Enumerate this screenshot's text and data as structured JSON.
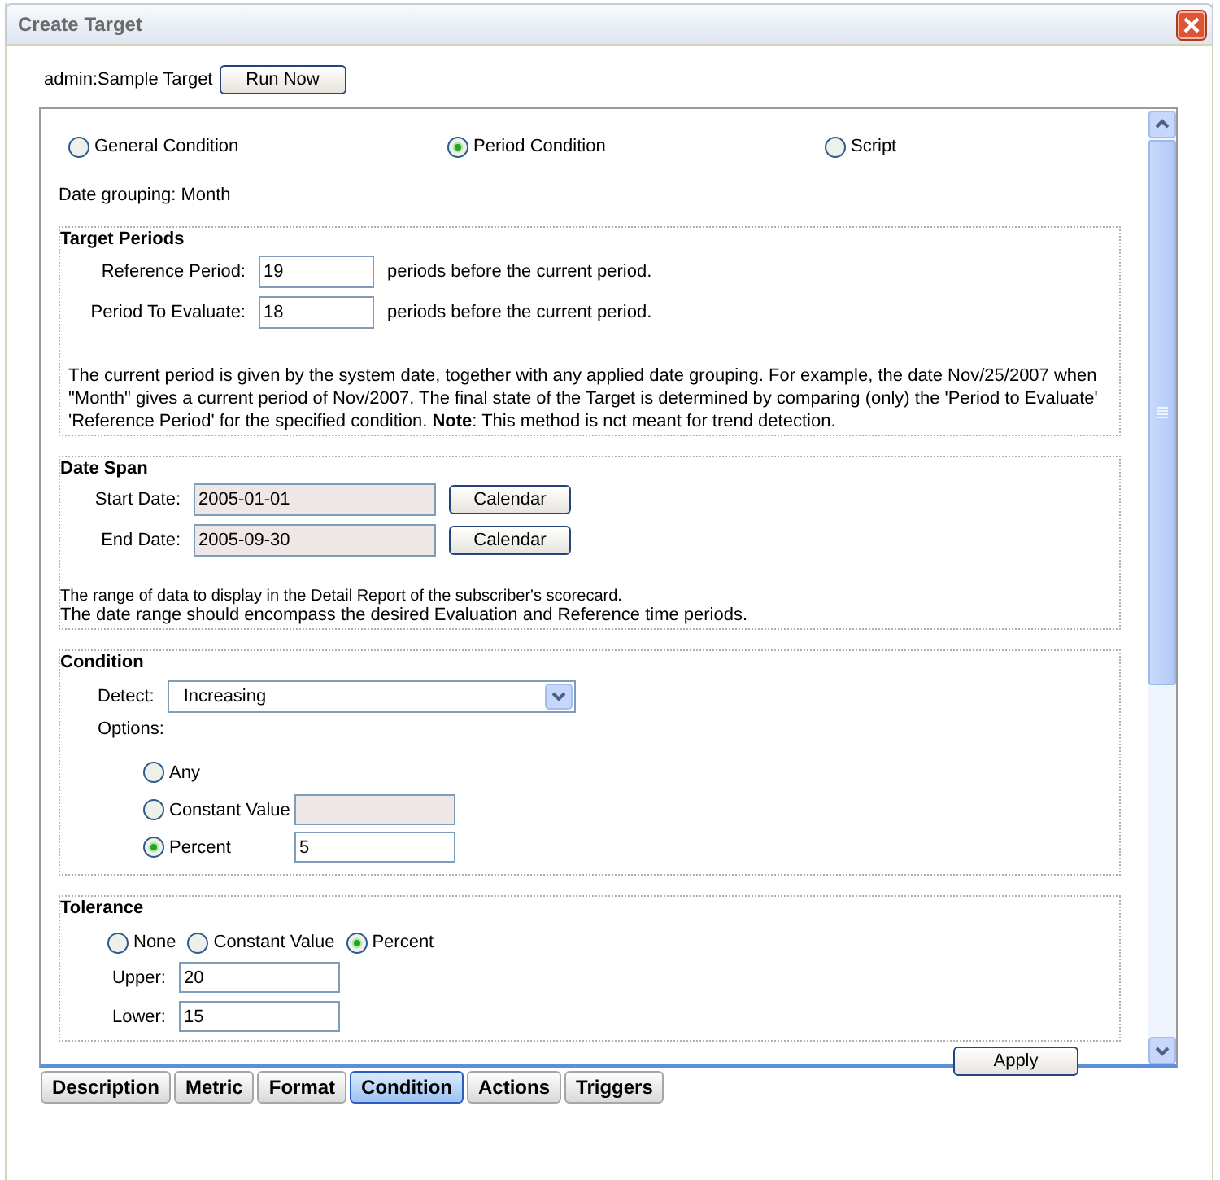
{
  "window": {
    "title": "Create Target"
  },
  "header": {
    "target": "admin:Sample Target",
    "run_button": "Run Now"
  },
  "condition_types": [
    {
      "label": "General Condition",
      "selected": false
    },
    {
      "label": "Period Condition",
      "selected": true
    },
    {
      "label": "Script",
      "selected": false
    }
  ],
  "date_grouping": "Date grouping: Month",
  "target_periods": {
    "title": "Target Periods",
    "fields": [
      {
        "label": "Reference Period:",
        "value": "19",
        "suffix": "periods before the current period."
      },
      {
        "label": "Period To Evaluate:",
        "value": "18",
        "suffix": "periods before the current period."
      }
    ],
    "note": "The current period is given by the system date, together with any applied date grouping. For example, the date Nov/25/2007 when\n\"Month\" gives a current period of Nov/2007. The final state of the Target is determined by comparing (only) the 'Period to Evaluate'\n'Reference Period' for the specified condition. **Note**: This method is nct meant for trend detection."
  },
  "date_span": {
    "title": "Date Span",
    "fields": [
      {
        "label": "Start Date:",
        "value": "2005-01-01",
        "button": "Calendar"
      },
      {
        "label": "End Date:",
        "value": "2005-09-30",
        "button": "Calendar"
      }
    ],
    "hint": "The range of data to display in the Detail Report of the subscriber's scorecard.",
    "note": "The date range should encompass the desired Evaluation and Reference time periods."
  },
  "condition": {
    "title": "Condition",
    "detect_label": "Detect:",
    "detect_value": "Increasing",
    "options_label": "Options:",
    "options": [
      {
        "kind": "plain",
        "label": "Any",
        "selected": false
      },
      {
        "kind": "field",
        "label": "Constant Value",
        "selected": false,
        "field": {
          "disabled": true
        }
      },
      {
        "kind": "field",
        "label": "Percent",
        "selected": true,
        "field": {
          "disabled": false,
          "value": "5"
        }
      }
    ]
  },
  "tolerance": {
    "title": "Tolerance",
    "modes": [
      {
        "label": "None",
        "selected": false
      },
      {
        "label": "Constant Value",
        "selected": false
      },
      {
        "label": "Percent",
        "selected": true
      }
    ],
    "fields": [
      {
        "label": "Upper:",
        "value": "20"
      },
      {
        "label": "Lower:",
        "value": "15"
      }
    ]
  },
  "apply_button": "Apply",
  "tabs": [
    {
      "label": "Description",
      "selected": false
    },
    {
      "label": "Metric",
      "selected": false
    },
    {
      "label": "Format",
      "selected": false
    },
    {
      "label": "Condition",
      "selected": true
    },
    {
      "label": "Actions",
      "selected": false
    },
    {
      "label": "Triggers",
      "selected": false
    }
  ]
}
